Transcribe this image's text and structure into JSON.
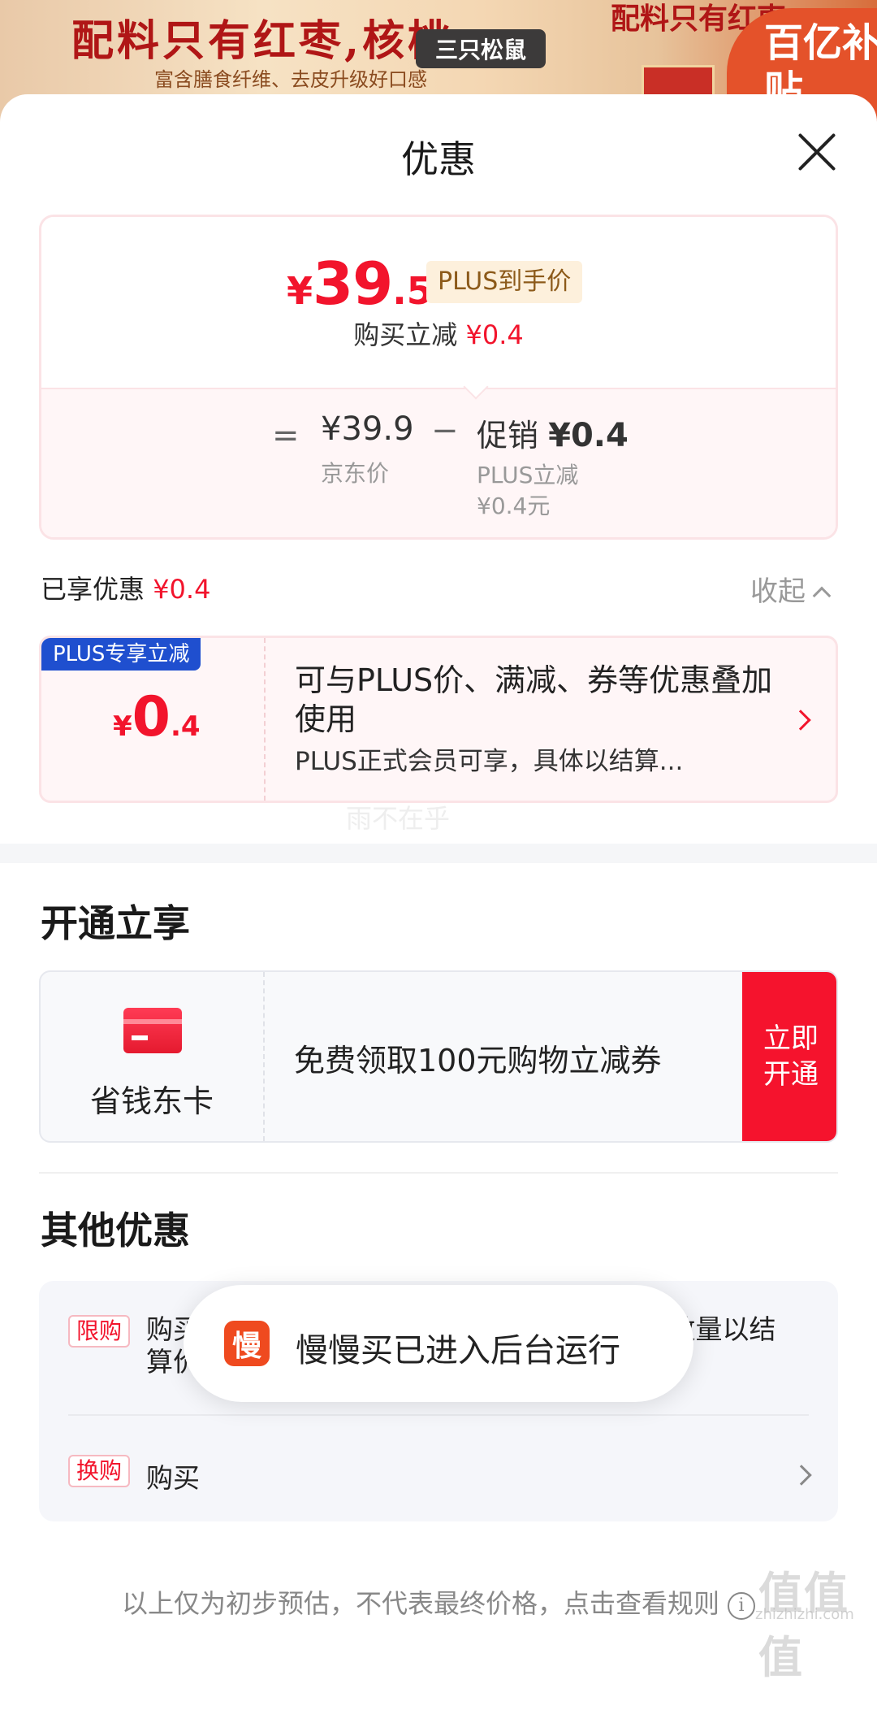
{
  "background": {
    "banner_title": "配料只有红枣,核桃",
    "banner_subtitle": "富含膳食纤维、去皮升级好口感",
    "brand": "三只松鼠",
    "banner_title_right": "配料只有红枣",
    "badge": "百亿补贴"
  },
  "sheet": {
    "title": "优惠",
    "close_label": "×"
  },
  "price_summary": {
    "yen": "¥",
    "final_int": "39",
    "final_dec": ".5",
    "plus_tag": "PLUS到手价",
    "instant_label": "购买立减",
    "instant_amount": "¥0.4",
    "equals": "=",
    "jd_price": "¥39.9",
    "jd_label": "京东价",
    "minus": "−",
    "promo_label": "促销",
    "promo_amount": "¥0.4",
    "promo_sub1": "PLUS立减",
    "promo_sub2": "¥0.4元"
  },
  "enjoyed": {
    "label": "已享优惠",
    "amount": "¥0.4",
    "collapse_label": "收起"
  },
  "plus_coupon": {
    "tag": "PLUS专享立减",
    "yen": "¥",
    "amount_int": "0",
    "amount_dec": ".4",
    "description": "可与PLUS价、满减、券等优惠叠加使用",
    "note": "PLUS正式会员可享，具体以结算..."
  },
  "watermark": "雨不在乎",
  "open_section": {
    "title": "开通立享",
    "card_name": "省钱东卡",
    "offer": "免费领取100元购物立减券",
    "button": "立即开通"
  },
  "other_section": {
    "title": "其他优惠",
    "items": [
      {
        "badge": "限购",
        "text": "购买至少1件时可享受单件价￥39.90，超出数量以结算价为准"
      },
      {
        "badge": "换购",
        "text": "购买"
      }
    ]
  },
  "toast": {
    "icon_char": "慢",
    "text": "慢慢买已进入后台运行"
  },
  "footnote": {
    "text": "以上仅为初步预估，不代表最终价格，点击查看规则",
    "info_icon": "i"
  },
  "corner_watermark": {
    "text": "值值值",
    "url": "zhizhizhi.com"
  },
  "colors": {
    "accent_red": "#f2142c",
    "plus_blue": "#1f4fcf",
    "plus_gold_bg": "#fdf0dc"
  }
}
